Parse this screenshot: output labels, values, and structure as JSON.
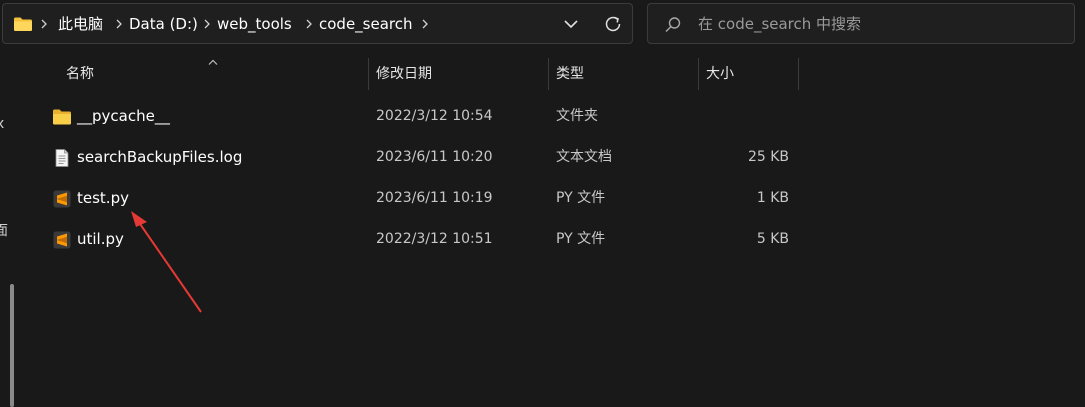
{
  "address_bar": {
    "folder_icon": "folder-icon",
    "breadcrumbs": [
      "此电脑",
      "Data (D:)",
      "web_tools",
      "code_search"
    ],
    "dropdown_icon": "chevron-down-icon",
    "refresh_icon": "refresh-icon"
  },
  "search": {
    "placeholder": "在 code_search 中搜索",
    "value": "",
    "icon": "search-icon"
  },
  "nav_pane": {
    "glyphs": [
      "x",
      "面"
    ]
  },
  "columns": [
    {
      "label": "名称"
    },
    {
      "label": "修改日期"
    },
    {
      "label": "类型"
    },
    {
      "label": "大小"
    }
  ],
  "sort": {
    "column": "名称",
    "icon": "sort-up-icon"
  },
  "files": [
    {
      "name": "__pycache__",
      "modified": "2022/3/12 10:54",
      "type": "文件夹",
      "size": "",
      "icon": "folder-icon"
    },
    {
      "name": "searchBackupFiles.log",
      "modified": "2023/6/11 10:20",
      "type": "文本文档",
      "size": "25 KB",
      "icon": "text-document-icon"
    },
    {
      "name": "test.py",
      "modified": "2023/6/11 10:19",
      "type": "PY 文件",
      "size": "1 KB",
      "icon": "sublime-text-icon"
    },
    {
      "name": "util.py",
      "modified": "2022/3/12 10:51",
      "type": "PY 文件",
      "size": "5 KB",
      "icon": "sublime-text-icon"
    }
  ],
  "colors": {
    "background": "#191919",
    "folder": "#F3C13A",
    "sublime": "#FF9800",
    "annotation_arrow": "#E53935"
  }
}
